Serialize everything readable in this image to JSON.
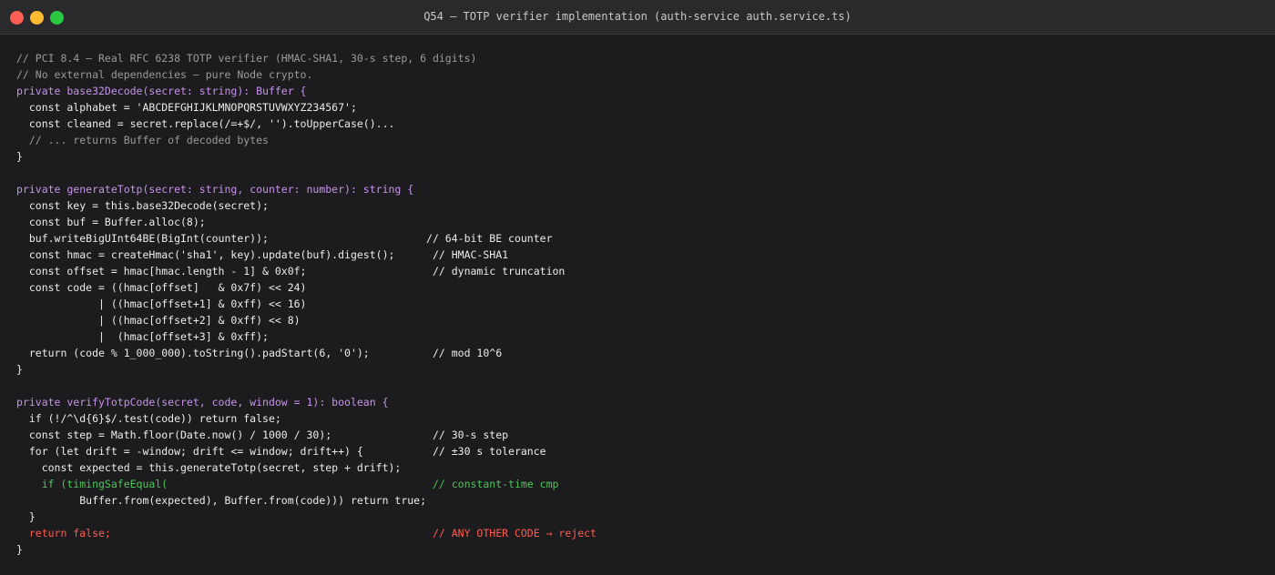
{
  "window": {
    "title": "Q54 — TOTP verifier implementation (auth-service auth.service.ts)"
  },
  "code": {
    "lines": [
      {
        "text": "// PCI 8.4 — Real RFC 6238 TOTP verifier (HMAC-SHA1, 30-s step, 6 digits)",
        "style": "comment"
      },
      {
        "text": "// No external dependencies — pure Node crypto.",
        "style": "comment"
      },
      {
        "text": "private base32Decode(secret: string): Buffer {",
        "style": "decl"
      },
      {
        "text": "  const alphabet = 'ABCDEFGHIJKLMNOPQRSTUVWXYZ234567';",
        "style": "normal"
      },
      {
        "text": "  const cleaned = secret.replace(/=+$/, '').toUpperCase()...",
        "style": "normal"
      },
      {
        "text": "  // ... returns Buffer of decoded bytes",
        "style": "comment"
      },
      {
        "text": "}",
        "style": "normal"
      },
      {
        "text": "",
        "style": "normal"
      },
      {
        "text": "private generateTotp(secret: string, counter: number): string {",
        "style": "decl"
      },
      {
        "text": "  const key = this.base32Decode(secret);",
        "style": "normal"
      },
      {
        "text": "  const buf = Buffer.alloc(8);",
        "style": "normal"
      },
      {
        "text": "  buf.writeBigUInt64BE(BigInt(counter));                         // 64-bit BE counter",
        "style": "normal"
      },
      {
        "text": "  const hmac = createHmac('sha1', key).update(buf).digest();      // HMAC-SHA1",
        "style": "normal"
      },
      {
        "text": "  const offset = hmac[hmac.length - 1] & 0x0f;                    // dynamic truncation",
        "style": "normal"
      },
      {
        "text": "  const code = ((hmac[offset]   & 0x7f) << 24)",
        "style": "normal"
      },
      {
        "text": "             | ((hmac[offset+1] & 0xff) << 16)",
        "style": "normal"
      },
      {
        "text": "             | ((hmac[offset+2] & 0xff) << 8)",
        "style": "normal"
      },
      {
        "text": "             |  (hmac[offset+3] & 0xff);",
        "style": "normal"
      },
      {
        "text": "  return (code % 1_000_000).toString().padStart(6, '0');          // mod 10^6",
        "style": "normal"
      },
      {
        "text": "}",
        "style": "normal"
      },
      {
        "text": "",
        "style": "normal"
      },
      {
        "text": "private verifyTotpCode(secret, code, window = 1): boolean {",
        "style": "decl"
      },
      {
        "text": "  if (!/^\\d{6}$/.test(code)) return false;",
        "style": "normal"
      },
      {
        "text": "  const step = Math.floor(Date.now() / 1000 / 30);                // 30-s step",
        "style": "normal"
      },
      {
        "text": "  for (let drift = -window; drift <= window; drift++) {           // ±30 s tolerance",
        "style": "normal"
      },
      {
        "text": "    const expected = this.generateTotp(secret, step + drift);",
        "style": "normal"
      },
      {
        "text": "    if (timingSafeEqual(                                          // constant-time cmp",
        "style": "green"
      },
      {
        "text": "          Buffer.from(expected), Buffer.from(code))) return true;",
        "style": "normal"
      },
      {
        "text": "  }",
        "style": "normal"
      },
      {
        "text": "  return false;                                                   // ANY OTHER CODE → reject",
        "style": "red"
      },
      {
        "text": "}",
        "style": "normal"
      }
    ]
  }
}
